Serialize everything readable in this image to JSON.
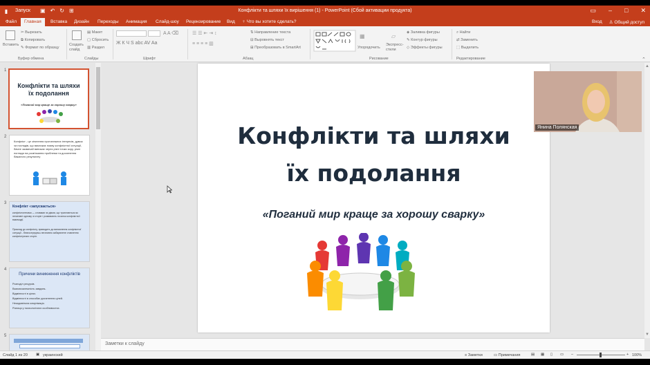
{
  "titlebar": {
    "autosave": "Запуск",
    "document_title": "Конфлікти та шляхи їх вирішення (1) - PowerPoint (Сбой активации продукта)"
  },
  "tabs": {
    "items": [
      "Файл",
      "Главная",
      "Вставка",
      "Дизайн",
      "Переходы",
      "Анимация",
      "Слайд-шоу",
      "Рецензирование",
      "Вид"
    ],
    "tell_me": "Что вы хотите сделать?",
    "signin": "Вход",
    "share": "Общий доступ"
  },
  "ribbon": {
    "paste": "Вставить",
    "cut": "Вырезать",
    "copy": "Копировать",
    "format_painter": "Формат по образцу",
    "clipboard_group": "Буфер обмена",
    "new_slide": "Создать слайд",
    "layout": "Макет",
    "reset": "Сбросить",
    "section": "Раздел",
    "slides_group": "Слайды",
    "font_group": "Шрифт",
    "text_direction": "Направление текста",
    "align_text": "Выровнять текст",
    "convert_smartart": "Преобразовать в SmartArt",
    "paragraph_group": "Абзац",
    "arrange": "Упорядочить",
    "quick_styles": "Экспресс-стили",
    "shape_fill": "Заливка фигуры",
    "shape_outline": "Контур фигуры",
    "shape_effects": "Эффекты фигуры",
    "drawing_group": "Рисование",
    "find": "Найти",
    "replace": "Заменить",
    "select": "Выделить",
    "editing_group": "Редактирование"
  },
  "thumbnails": {
    "numbers": [
      "1",
      "2",
      "3",
      "4",
      "5"
    ],
    "t1_title": "Конфлікти та шляхи їх подолання",
    "t1_sub": "«Поганий мир краще за хорошу сварку»",
    "t2_text": "Конфлікт - це зіткнення протилежних інтересів, думок чи поглядів, що викликає появу конфліктної ситуації, бачне зазвичай виникає через різні точки зору, різні погляди на розв'язання проблеми та досягнення бажаного результату",
    "t3_title": "Конфлікт «запускається»",
    "t3_text1": "конфліктогенами — словами чи діями, що трапляються як негативні одному зі сторін і розвивають початок конфліктної взаємодії.",
    "t3_text2": "Приклад до конфлікту, приводить до виникнення конфліктної ситуації - безпосередньо-негативно забарвлене ставлення конфліктуючих сторін.",
    "t4_title": "Причини виникнення конфліктів",
    "t4_items": [
      "Розподіл ресурсів.",
      "Взаємозалежність завдань.",
      "Відмінності в цілях.",
      "Відмінності в способах досягнення цілей.",
      "Незадовільна комунікація.",
      "Різниця у психологічних особливостях."
    ]
  },
  "slide": {
    "title_line1": "Конфлікти та шляхи",
    "title_line2": "їх подолання",
    "subtitle": "«Поганий мир краще за хорошу сварку»"
  },
  "video": {
    "participant_name": "Янина Полянская"
  },
  "notes": {
    "placeholder": "Заметки к слайду"
  },
  "status": {
    "slide_counter": "Слайд 1 из 20",
    "language": "украинский",
    "notes_btn": "Заметки",
    "comments_btn": "Примечания",
    "zoom": "100%"
  },
  "colors": {
    "accent": "#c43e1c",
    "title_text": "#1f2d3d"
  }
}
